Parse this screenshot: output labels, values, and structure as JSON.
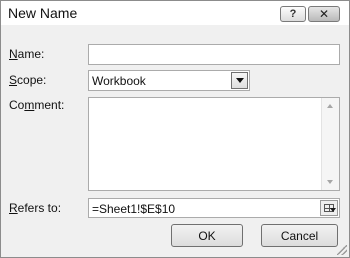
{
  "dialog": {
    "title": "New Name",
    "help_glyph": "?",
    "close_glyph": "✕"
  },
  "fields": {
    "name": {
      "label_access_key": "N",
      "label_rest": "ame:",
      "value": ""
    },
    "scope": {
      "label_access_key": "S",
      "label_rest": "cope:",
      "value": "Workbook"
    },
    "comment": {
      "label_pre": "Co",
      "label_access_key": "m",
      "label_rest": "ment:",
      "value": ""
    },
    "refers_to": {
      "label_access_key": "R",
      "label_rest": "efers to:",
      "value": "=Sheet1!$E$10"
    }
  },
  "buttons": {
    "ok": "OK",
    "cancel": "Cancel"
  },
  "icons": {
    "help": "help-icon",
    "close": "close-icon",
    "dropdown": "chevron-down-icon",
    "range_select": "range-select-icon",
    "resize": "resize-grip-icon"
  }
}
